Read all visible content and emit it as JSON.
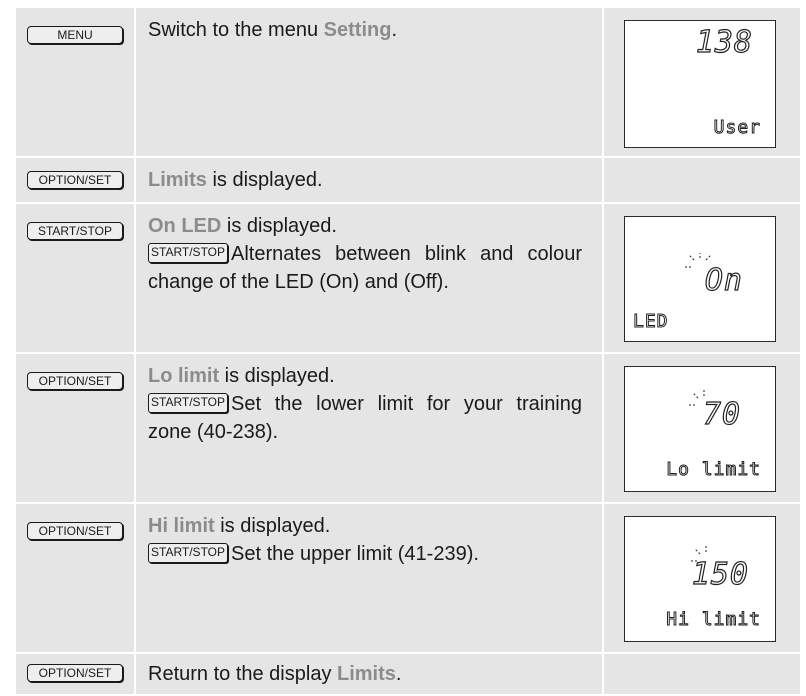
{
  "buttons": {
    "menu": "MENU",
    "option_set": "OPTION/SET",
    "start_stop": "START/STOP"
  },
  "rows": [
    {
      "key": "MENU",
      "pre": "Switch to the menu ",
      "highlight": "Setting",
      "post": ".",
      "display": {
        "digits": "138",
        "label": "User"
      }
    },
    {
      "key": "OPTION/SET",
      "highlight": "Limits",
      "post": " is displayed."
    },
    {
      "key": "START/STOP",
      "highlight": "On LED",
      "post": " is displayed.",
      "sub_key": "START/STOP",
      "sub_text": "Alternates between blink and colour change of the LED (On) and (Off).",
      "display": {
        "digits": "On",
        "label": "LED"
      }
    },
    {
      "key": "OPTION/SET",
      "highlight": "Lo limit",
      "post": " is displayed.",
      "sub_key": "START/STOP",
      "sub_text": "Set the lower limit for your training zone (40-238).",
      "display": {
        "digits": "70",
        "label": "Lo limit"
      }
    },
    {
      "key": "OPTION/SET",
      "highlight": "Hi limit",
      "post": " is displayed.",
      "sub_key": "START/STOP",
      "sub_text": "Set the upper limit (41-239).",
      "display": {
        "digits": "150",
        "label": "Hi limit"
      }
    },
    {
      "key": "OPTION/SET",
      "pre": "Return to the display ",
      "highlight": "Limits",
      "post": "."
    }
  ]
}
